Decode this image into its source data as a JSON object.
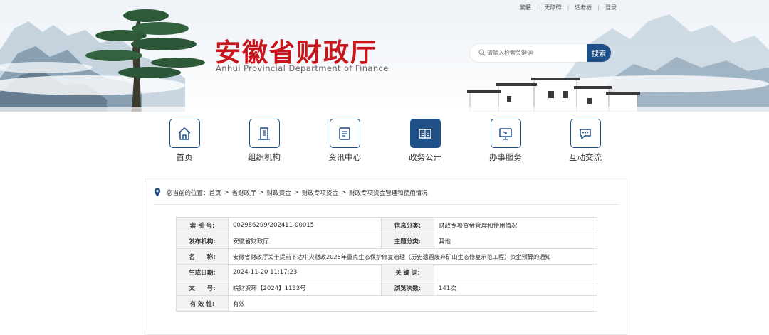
{
  "header": {
    "top_links": [
      "繁體",
      "无障碍",
      "适老板",
      "登录"
    ],
    "site_title": "安徽省财政厅",
    "site_subtitle": "Anhui Provincial Department of Finance",
    "search": {
      "placeholder": "请输入检索关键词",
      "button_label": "搜索"
    }
  },
  "nav": {
    "items": [
      {
        "label": "首页",
        "icon": "home-icon",
        "active": false
      },
      {
        "label": "组织机构",
        "icon": "building-icon",
        "active": false
      },
      {
        "label": "资讯中心",
        "icon": "news-icon",
        "active": false
      },
      {
        "label": "政务公开",
        "icon": "book-icon",
        "active": true
      },
      {
        "label": "办事服务",
        "icon": "monitor-service-icon",
        "active": false
      },
      {
        "label": "互动交流",
        "icon": "chat-icon",
        "active": false
      }
    ]
  },
  "breadcrumb": {
    "prefix": "您当前的位置：",
    "items": [
      "首页",
      "省财政厅",
      "财政资金",
      "财政专项资金",
      "财政专项资金管理和使用情况"
    ],
    "separator": ">"
  },
  "meta_table": {
    "index_label": "索 引 号:",
    "index_value": "002986299/202411-00015",
    "category_label": "信息分类:",
    "category_value": "财政专项资金管理和使用情况",
    "publisher_label": "发布机构:",
    "publisher_value": "安徽省财政厅",
    "topic_label": "主题分类:",
    "topic_value": "其他",
    "name_label": "名　　称:",
    "name_value": "安徽省财政厅关于提前下达中央财政2025年重点生态保护修复治理（历史遗留废弃矿山生态修复示范工程）资金预算的通知",
    "date_label": "生成日期:",
    "date_value": "2024-11-20 11:17:23",
    "keywords_label": "关 键 词:",
    "keywords_value": "",
    "docno_label": "文　　号:",
    "docno_value": "皖财资环【2024】1133号",
    "views_label": "浏览次数:",
    "views_value": "141次",
    "validity_label": "有 效 性:",
    "validity_value": "有效"
  },
  "colors": {
    "brand_red": "#c8161d",
    "brand_blue": "#1f4f87"
  }
}
